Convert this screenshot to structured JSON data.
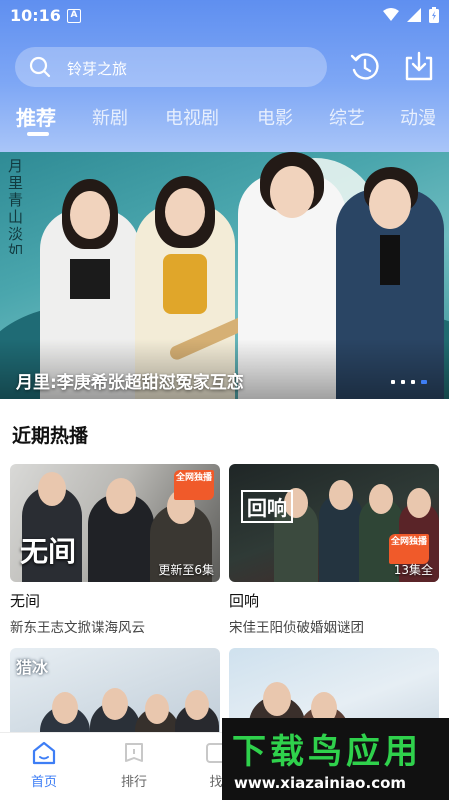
{
  "status_bar": {
    "time": "10:16",
    "notification_icon": "A",
    "icons": [
      "wifi-icon",
      "signal-icon",
      "battery-icon"
    ]
  },
  "search": {
    "text": "铃芽之旅"
  },
  "header_actions": [
    "history-icon",
    "download-icon"
  ],
  "tabs": [
    {
      "label": "推荐",
      "active": true
    },
    {
      "label": "新剧",
      "active": false
    },
    {
      "label": "电视剧",
      "active": false
    },
    {
      "label": "电影",
      "active": false
    },
    {
      "label": "综艺",
      "active": false
    },
    {
      "label": "动漫",
      "active": false
    }
  ],
  "banner": {
    "title": "月里:李庚希张超甜怼冤家互恋",
    "poster_calligraphy": "月里青山淡如画",
    "slide_count": 4,
    "active_slide": 4
  },
  "section": {
    "title": "近期热播"
  },
  "cards": [
    {
      "title": "无间",
      "desc": "新东王志文掀谍海风云",
      "thumb_label": "更新至6集",
      "badge": "全网独播",
      "logo": "无间"
    },
    {
      "title": "回响",
      "desc": "宋佳王阳侦破婚姻谜团",
      "thumb_label": "13集全",
      "badge": "全网独播",
      "logo": "回响"
    },
    {
      "title": "",
      "desc": "",
      "thumb_label": "",
      "badge": "",
      "logo": "猎冰"
    },
    {
      "title": "",
      "desc": "",
      "thumb_label": "",
      "badge": "",
      "logo": ""
    }
  ],
  "bottom_nav": [
    {
      "label": "首页",
      "icon": "home-icon",
      "active": true
    },
    {
      "label": "排行",
      "icon": "ranking-icon",
      "active": false
    },
    {
      "label": "找",
      "icon": "find-icon",
      "active": false
    }
  ],
  "watermark": {
    "title": "下载鸟应用",
    "url": "www.xiazainiao.com"
  },
  "colors": {
    "accent": "#3e7ef5",
    "header_top": "#5f8ff0",
    "badge": "#f05a2a",
    "watermark_green": "#2fd14c"
  }
}
